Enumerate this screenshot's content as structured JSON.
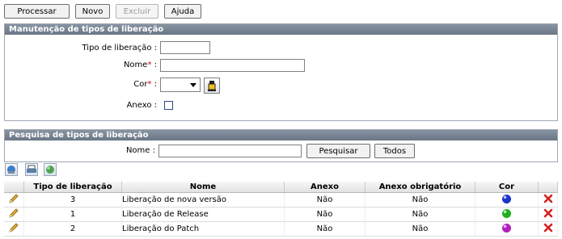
{
  "toolbar": {
    "processar": "Processar",
    "novo": "Novo",
    "excluir": "Excluir",
    "ajuda": "Ajuda"
  },
  "manutencao": {
    "title": "Manutenção de tipos de liberação",
    "tipo_label": "Tipo de liberação :",
    "nome_label": "Nome",
    "cor_label": "Cor",
    "anexo_label": "Anexo :",
    "required_mark": "*",
    "colon": " :",
    "tipo_value": "",
    "nome_value": ""
  },
  "pesquisa": {
    "title": "Pesquisa de tipos de liberação",
    "nome_label": "Nome :",
    "nome_value": "",
    "pesquisar": "Pesquisar",
    "todos": "Todos"
  },
  "table": {
    "headers": [
      "Tipo de liberação",
      "Nome",
      "Anexo",
      "Anexo obrigatório",
      "Cor"
    ],
    "rows": [
      {
        "tipo": "3",
        "nome": "Liberação de nova versão",
        "anexo": "Não",
        "obrigatorio": "Não",
        "cor": "#1c33c8"
      },
      {
        "tipo": "1",
        "nome": "Liberação de Release",
        "anexo": "Não",
        "obrigatorio": "Não",
        "cor": "#1fae1f"
      },
      {
        "tipo": "2",
        "nome": "Liberação do Patch",
        "anexo": "Não",
        "obrigatorio": "Não",
        "cor": "#b21fc0"
      }
    ]
  },
  "colors": {
    "panel_header": "#75808f",
    "delete": "#d42020"
  }
}
